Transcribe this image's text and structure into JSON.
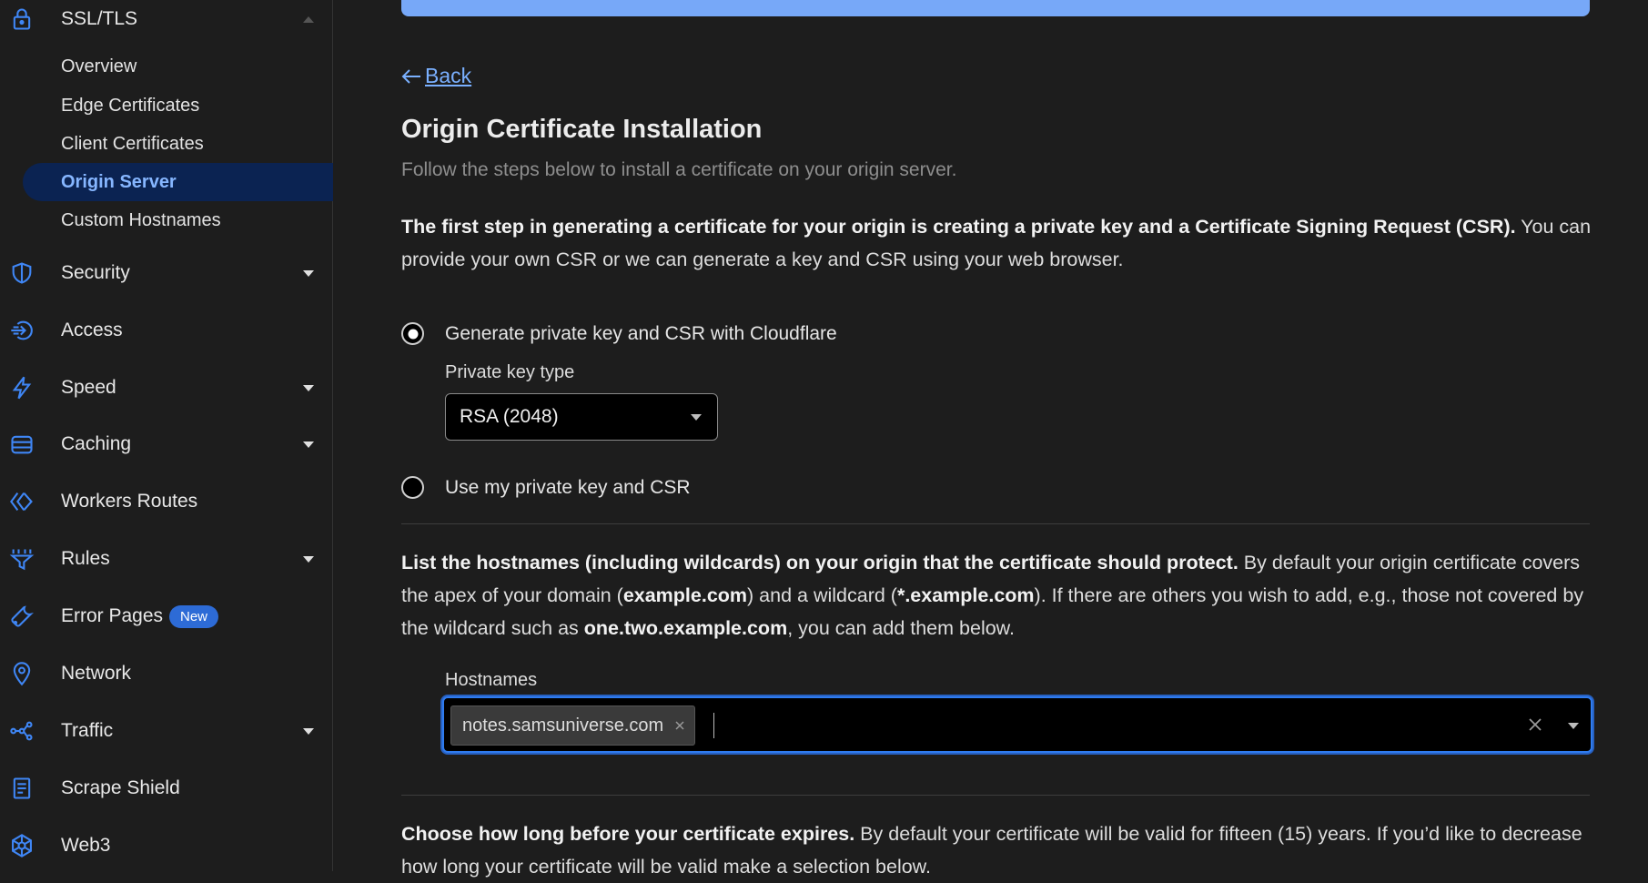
{
  "sidebar": {
    "section_ssl": {
      "label": "SSL/TLS",
      "icon": "lock-icon"
    },
    "sub_items": [
      {
        "label": "Overview"
      },
      {
        "label": "Edge Certificates"
      },
      {
        "label": "Client Certificates"
      },
      {
        "label": "Origin Server",
        "active": true
      },
      {
        "label": "Custom Hostnames"
      }
    ],
    "items": [
      {
        "label": "Security",
        "icon": "shield-icon",
        "expandable": true
      },
      {
        "label": "Access",
        "icon": "access-icon",
        "expandable": false
      },
      {
        "label": "Speed",
        "icon": "lightning-icon",
        "expandable": true
      },
      {
        "label": "Caching",
        "icon": "database-icon",
        "expandable": true
      },
      {
        "label": "Workers Routes",
        "icon": "workers-icon",
        "expandable": false
      },
      {
        "label": "Rules",
        "icon": "funnel-icon",
        "expandable": true
      },
      {
        "label": "Error Pages",
        "icon": "wrench-icon",
        "expandable": false,
        "badge": "New"
      },
      {
        "label": "Network",
        "icon": "location-pin-icon",
        "expandable": false
      },
      {
        "label": "Traffic",
        "icon": "traffic-icon",
        "expandable": true
      },
      {
        "label": "Scrape Shield",
        "icon": "document-icon",
        "expandable": false
      },
      {
        "label": "Web3",
        "icon": "web3-icon",
        "expandable": false
      }
    ]
  },
  "main": {
    "back_label": "Back",
    "title": "Origin Certificate Installation",
    "subtitle": "Follow the steps below to install a certificate on your origin server.",
    "step1": {
      "bold": "The first step in generating a certificate for your origin is creating a private key and a Certificate Signing Request (CSR).",
      "rest": " You can provide your own CSR or we can generate a key and CSR using your web browser."
    },
    "options": {
      "generate_label": "Generate private key and CSR with Cloudflare",
      "own_label": "Use my private key and CSR",
      "selected": "generate"
    },
    "key_type": {
      "label": "Private key type",
      "value": "RSA (2048)"
    },
    "hostnames_para": {
      "bold": "List the hostnames (including wildcards) on your origin that the certificate should protect.",
      "part1": " By default your origin certificate covers the apex of your domain (",
      "apex": "example.com",
      "part2": ") and a wildcard (",
      "wildcard": "*.example.com",
      "part3": "). If there are others you wish to add, e.g., those not covered by the wildcard such as ",
      "example": "one.two.example.com",
      "part4": ", you can add them below."
    },
    "hostnames": {
      "label": "Hostnames",
      "chips": [
        "notes.samsuniverse.com"
      ]
    },
    "expiry_para": {
      "bold": "Choose how long before your certificate expires.",
      "rest": " By default your certificate will be valid for fifteen (15) years. If you’d like to decrease how long your certificate will be valid make a selection below."
    }
  },
  "colors": {
    "accent": "#2f7cf0",
    "active_bg": "#0b2352",
    "link": "#7ab0ff",
    "badge": "#2d6bd6",
    "background": "#1d1d1d"
  }
}
